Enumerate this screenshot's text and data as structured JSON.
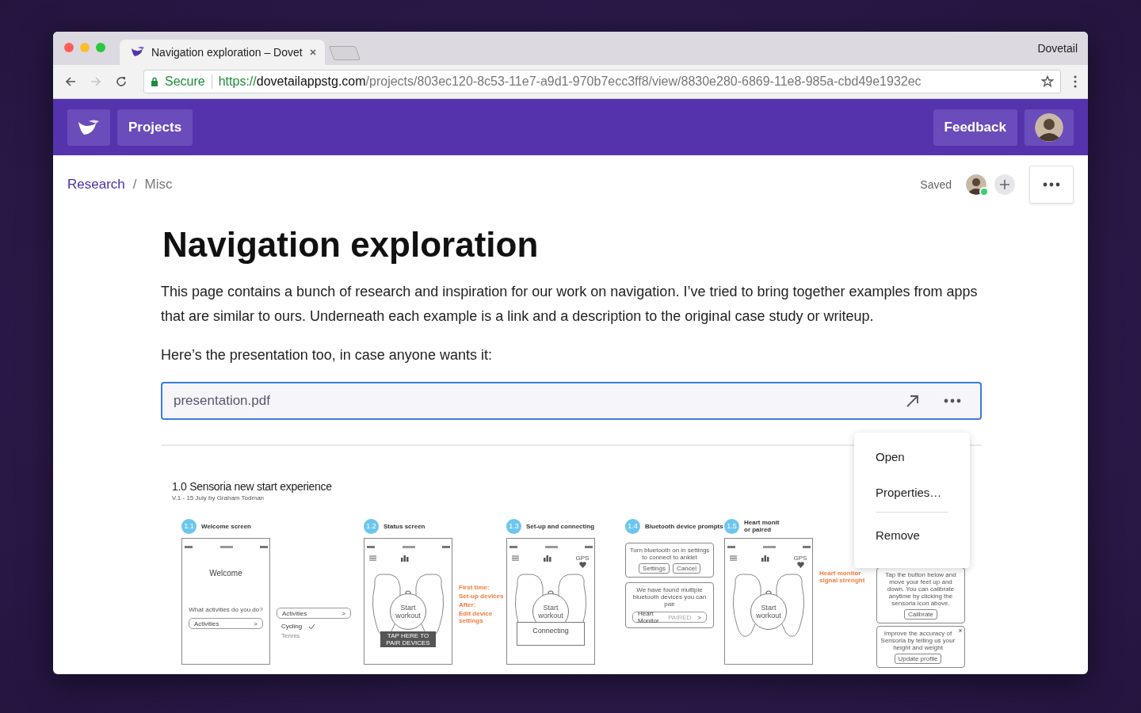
{
  "browser": {
    "tab_title": "Navigation exploration – Dovet",
    "profile": "Dovetail",
    "security": "Secure",
    "url_scheme": "https://",
    "url_host": "dovetailappstg.com",
    "url_path": "/projects/803ec120-8c53-11e7-a9d1-970b7ecc3ff8/view/8830e280-6869-11e8-985a-cbd49e1932ec"
  },
  "header": {
    "nav": [
      {
        "label": "Projects"
      }
    ],
    "actions": [
      {
        "label": "Feedback"
      }
    ]
  },
  "breadcrumb": {
    "separator": "/",
    "items": [
      {
        "label": "Research",
        "kind": "link"
      },
      {
        "label": "Misc",
        "kind": "current"
      }
    ]
  },
  "save_status": "Saved",
  "collaborators": [
    {
      "online": true
    }
  ],
  "title": "Navigation exploration",
  "paragraphs": [
    "This page contains a bunch of research and inspiration for our work on navigation. I’ve tried to bring together examples from apps that are similar to ours. Underneath each example is a link and a description to the original case study or writeup.",
    "Here’s the presentation too, in case anyone wants it:"
  ],
  "attachment": {
    "name": "presentation.pdf",
    "focused": true
  },
  "menu": {
    "items": [
      {
        "kind": "item",
        "label": "Open"
      },
      {
        "kind": "item",
        "label": "Properties…"
      },
      {
        "kind": "divider"
      },
      {
        "kind": "item",
        "label": "Remove"
      }
    ]
  },
  "preview": {
    "title": "1.0 Sensoria new start experience",
    "subtitle": "V.1 - 15 July by Graham Todman",
    "steps": [
      {
        "number": "1.1",
        "title": [
          "Welcome screen"
        ],
        "columns": [
          [
            {
              "kind": "phone",
              "feet": false,
              "lines": [
                {
                  "kind": "heading",
                  "text": "Welcome"
                },
                {
                  "kind": "gap"
                },
                {
                  "kind": "text",
                  "text": "What activities do you do?"
                },
                {
                  "kind": "select",
                  "text": "Activities",
                  "arrow": ">"
                }
              ]
            }
          ],
          [
            {
              "kind": "list",
              "lines": [
                {
                  "kind": "select",
                  "text": "Activities",
                  "arrow": ">"
                },
                {
                  "kind": "check",
                  "text": "Cycling",
                  "checked": true
                },
                {
                  "kind": "check",
                  "text": "Tennis",
                  "checked": false
                }
              ]
            }
          ]
        ]
      },
      {
        "number": "1.2",
        "title": [
          "Status screen"
        ],
        "columns": [
          [
            {
              "kind": "phone",
              "feet": true,
              "lines": [
                {
                  "kind": "circle",
                  "text": "Start workout"
                },
                {
                  "kind": "dark",
                  "text": "TAP HERE TO PAIR DEVICES"
                }
              ]
            }
          ],
          [
            {
              "kind": "note",
              "lines": [
                {
                  "kind": "text",
                  "text": "First time:"
                },
                {
                  "kind": "text",
                  "text": "Set-up devices"
                },
                {
                  "kind": "text",
                  "text": "After:"
                },
                {
                  "kind": "text",
                  "text": "Edit device settings"
                }
              ]
            }
          ]
        ]
      },
      {
        "number": "1.3",
        "title": [
          "Set-up and connecting"
        ],
        "columns": [
          [
            {
              "kind": "phone",
              "feet": true,
              "gps": "GPS",
              "lines": [
                {
                  "kind": "circle",
                  "text": "Start workout"
                },
                {
                  "kind": "popup",
                  "text": "Connecting"
                }
              ]
            }
          ]
        ]
      },
      {
        "number": "1.4",
        "title": [
          "Bluetooth device prompts"
        ],
        "columns": [
          [
            {
              "kind": "card",
              "lines": [
                {
                  "kind": "text",
                  "text": "Turn bluetooth on in settings to connect to anklet"
                },
                {
                  "kind": "buttons",
                  "items": [
                    "Settings",
                    "Cancel"
                  ]
                }
              ]
            },
            {
              "kind": "card",
              "lines": [
                {
                  "kind": "text",
                  "text": "We have found multiple bluetooth devices you can pair"
                },
                {
                  "kind": "select",
                  "text": "Heart Monitor",
                  "tag": "PAIRED",
                  "arrow": ">"
                }
              ]
            }
          ]
        ]
      },
      {
        "number": "1.5",
        "title": [
          "Heart monit",
          "or paired"
        ],
        "columns": [
          [
            {
              "kind": "phone",
              "feet": true,
              "gps": "GPS",
              "lines": [
                {
                  "kind": "circle",
                  "text": "Start workout"
                }
              ]
            }
          ],
          [
            {
              "kind": "note",
              "lines": [
                {
                  "kind": "text",
                  "text": "Heart monitor signal strenght"
                }
              ]
            }
          ],
          [
            {
              "kind": "card",
              "lines": [
                {
                  "kind": "text",
                  "text": "Tap the button below and move your feet up and down. You can calibrate anytime by clicking the sensoria icon above."
                },
                {
                  "kind": "buttons",
                  "items": [
                    "Calibrate"
                  ]
                }
              ]
            },
            {
              "kind": "card",
              "close": "x",
              "lines": [
                {
                  "kind": "text",
                  "text": "Improve the accuracy of Sensoria by telling us your height and weight"
                },
                {
                  "kind": "buttons",
                  "items": [
                    "Update profile"
                  ]
                }
              ]
            }
          ]
        ]
      }
    ]
  }
}
